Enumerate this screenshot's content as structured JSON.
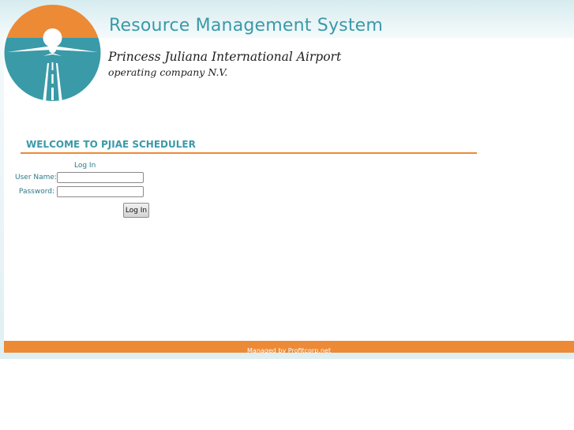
{
  "header": {
    "system_title": "Resource Management System",
    "airport_name": "Princess Juliana International Airport",
    "company_line": "operating company N.V."
  },
  "main": {
    "welcome_heading": "WELCOME TO PJIAE SCHEDULER"
  },
  "login": {
    "title": "Log In",
    "username_label": "User Name:",
    "password_label": "Password:",
    "username_value": "",
    "password_value": "",
    "submit_label": "Log In"
  },
  "footer": {
    "text": "Managed by Profitcorp.net"
  },
  "colors": {
    "accent_teal": "#3a9aa8",
    "accent_orange": "#ec8a36",
    "label_teal": "#2e7a86"
  },
  "icons": {
    "logo": "airport-runway-logo"
  }
}
